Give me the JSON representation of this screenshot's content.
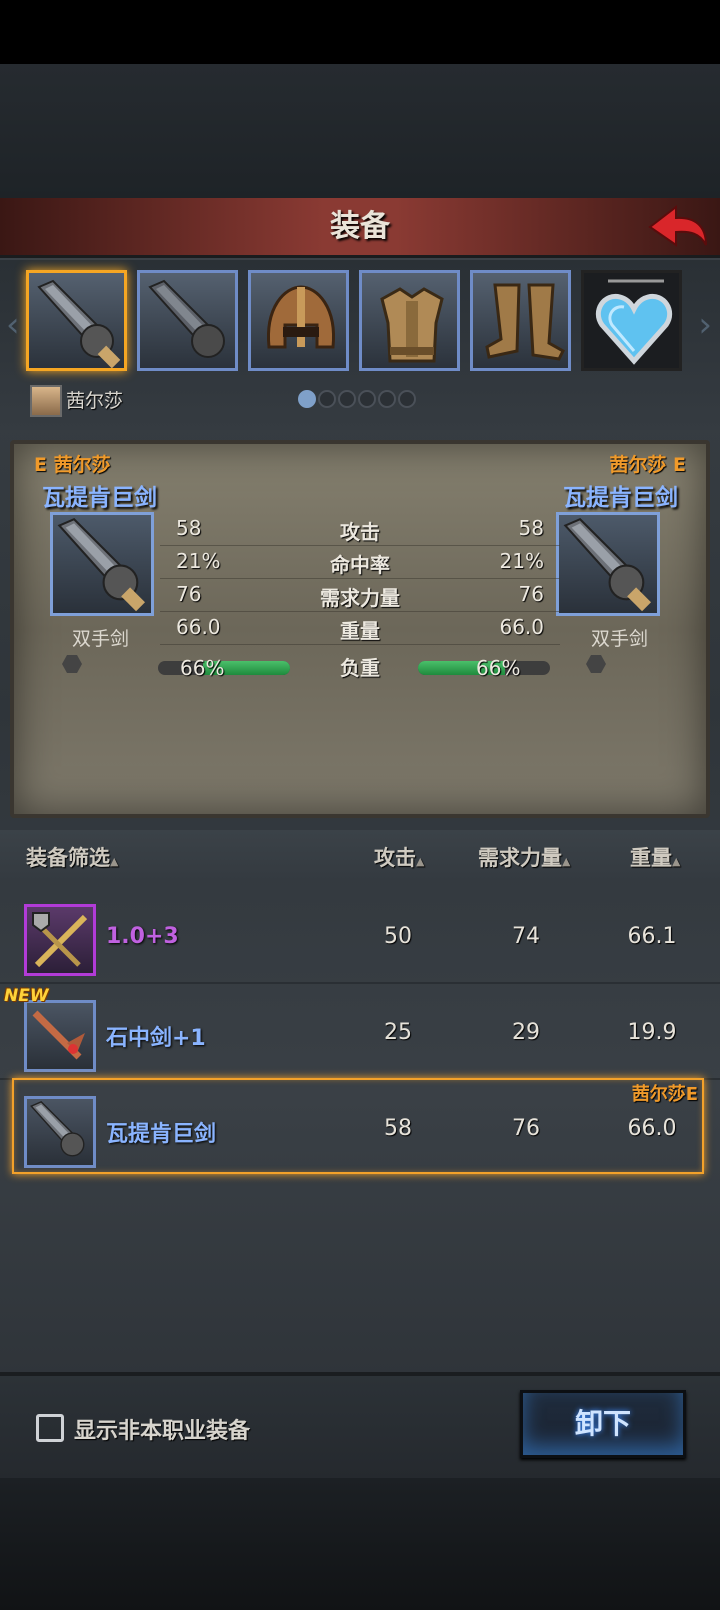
{
  "header": {
    "title": "装备"
  },
  "character": {
    "name": "茜尔莎"
  },
  "slots": [
    "sword-icon",
    "sword-icon",
    "helmet-icon",
    "armor-icon",
    "boots-icon",
    "heart-amulet-icon"
  ],
  "pager": {
    "pages": 6,
    "active": 1
  },
  "compare": {
    "left": {
      "owner": "E 茜尔莎",
      "name": "瓦提肯巨剑",
      "type": "双手剑",
      "attack": "58",
      "hit": "21%",
      "str": "76",
      "weight": "66.0",
      "load": "66%",
      "load_fraction": 0.66
    },
    "right": {
      "owner": "茜尔莎 E",
      "name": "瓦提肯巨剑",
      "type": "双手剑",
      "attack": "58",
      "hit": "21%",
      "str": "76",
      "weight": "66.0",
      "load": "66%",
      "load_fraction": 0.66
    },
    "labels": {
      "attack": "攻击",
      "hit": "命中率",
      "str": "需求力量",
      "weight": "重量",
      "load": "负重"
    }
  },
  "list": {
    "headers": {
      "filter": "装备筛选",
      "attack": "攻击",
      "str": "需求力量",
      "weight": "重量"
    },
    "items": [
      {
        "name": "1.0+3",
        "attack": "50",
        "str": "74",
        "weight": "66.1",
        "rarity_color": "#c061e0"
      },
      {
        "name": "石中剑+1",
        "attack": "25",
        "str": "29",
        "weight": "19.9",
        "rarity_color": "#8ab4ff",
        "badge": "NEW"
      },
      {
        "name": "瓦提肯巨剑",
        "attack": "58",
        "str": "76",
        "weight": "66.0",
        "rarity_color": "#8ab4ff",
        "equipped_by": "茜尔莎E"
      }
    ]
  },
  "footer": {
    "checkbox_label": "显示非本职业装备",
    "unequip_label": "卸下"
  }
}
